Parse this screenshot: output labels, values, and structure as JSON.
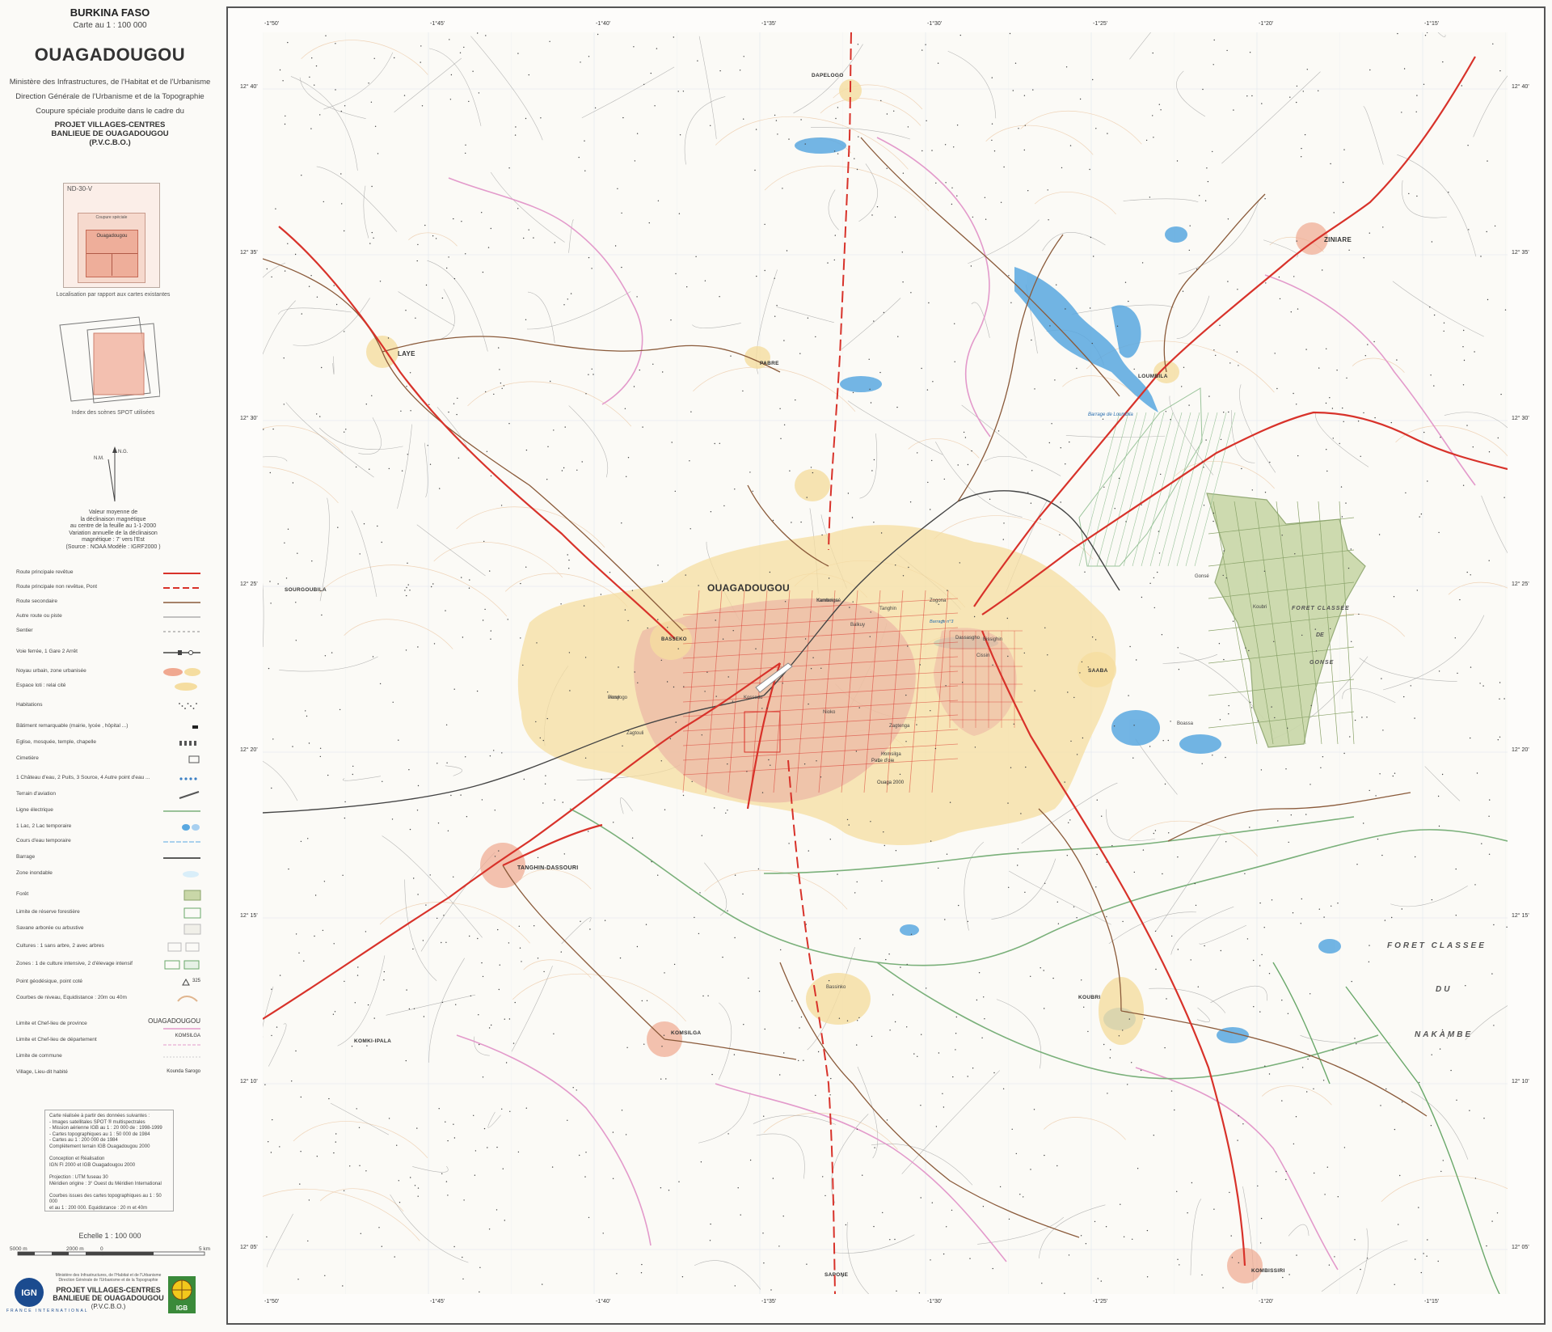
{
  "sidebar": {
    "country": "BURKINA FASO",
    "scale": "Carte au 1 : 100 000",
    "title": "OUAGADOUGOU",
    "ministry": "Ministère des Infrastructures, de l'Habitat et de l'Urbanisme",
    "direction": "Direction Générale de l'Urbanisme et de la Topographie",
    "coupure": "Coupure spéciale produite dans le cadre du",
    "project_1": "PROJET VILLAGES-CENTRES",
    "project_2": "BANLIEUE DE OUAGADOUGOU",
    "project_3": "(P.V.C.B.O.)",
    "location_sheet": "ND-30-V",
    "location_special": "Coupure spéciale",
    "location_city": "Ouagadougou",
    "location_caption": "Localisation par rapport aux cartes existantes",
    "spot_caption": "Index des scènes SPOT utilisées",
    "north_labels": {
      "ng": "N.G.",
      "nm": "N.M."
    },
    "declination_lines": [
      "Valeur moyenne de",
      "la déclinaison magnétique",
      "au centre de la feuille au 1-1-2000",
      "Variation annuelle de la déclinaison",
      "magnétique : 7' vers l'Est",
      "(Source : NOAA Modèle : IGRF2000 )"
    ]
  },
  "legend": [
    {
      "label": "Route principale revêtue",
      "symbol": "red-line"
    },
    {
      "label": "Route principale non revêtue,  Pont",
      "symbol": "red-dash"
    },
    {
      "label": "Route secondaire",
      "symbol": "brown-line"
    },
    {
      "label": "Autre route ou piste",
      "symbol": "grey-line"
    },
    {
      "label": "Sentier",
      "symbol": "grey-dash"
    },
    {
      "label": "Voie ferrée,  1 Gare  2 Arrêt",
      "symbol": "rail"
    },
    {
      "label": "Noyau urbain, zone urbanisée",
      "symbol": "urban"
    },
    {
      "label": "Espace loti : relai cité",
      "symbol": "yellow-fill"
    },
    {
      "label": "Habitations",
      "symbol": "dots"
    },
    {
      "label": "Bâtiment remarquable (mairie, lycée , hôpital ...)",
      "symbol": "black-block"
    },
    {
      "label": "Eglise, mosquée, temple, chapelle",
      "symbol": "church"
    },
    {
      "label": "Cimetière",
      "symbol": "cemetery"
    },
    {
      "label": "1 Château d'eau, 2 Puits, 3 Source, 4 Autre point d'eau ...",
      "symbol": "water-points"
    },
    {
      "label": "Terrain d'aviation",
      "symbol": "airfield"
    },
    {
      "label": "Ligne électrique",
      "symbol": "power"
    },
    {
      "label": "1 Lac, 2 Lac temporaire",
      "symbol": "lake"
    },
    {
      "label": "Cours d'eau temporaire",
      "symbol": "stream"
    },
    {
      "label": "Barrage",
      "symbol": "dam"
    },
    {
      "label": "Zone inondable",
      "symbol": "flood"
    },
    {
      "label": "Forêt",
      "symbol": "forest"
    },
    {
      "label": "Limite de réserve forestière",
      "symbol": "reserve"
    },
    {
      "label": "Savane arborée ou arbustive",
      "symbol": "savanna"
    },
    {
      "label": "Cultures : 1 sans arbre, 2 avec arbres",
      "symbol": "crops"
    },
    {
      "label": "Zones : 1 de culture intensive,   2 d'élevage intensif",
      "symbol": "zones"
    },
    {
      "label": "Point géodésique, point coté",
      "symbol": "geodetic"
    },
    {
      "label": "Courbes de niveau, Equidistance : 20m ou 40m",
      "symbol": "contours"
    },
    {
      "label": "Limite et Chef-lieu de province",
      "symbol": "province"
    },
    {
      "label": "Limite et Chef-lieu de département",
      "symbol": "department"
    },
    {
      "label": "Limite de commune",
      "symbol": "commune"
    },
    {
      "label": "Village, Lieu-dit habité",
      "symbol": "village"
    }
  ],
  "legend_values": {
    "province": "OUAGADOUGOU",
    "department": "KOMSILGA",
    "village_1": "Kounda",
    "village_2": "Sarogo",
    "geodetic": "325"
  },
  "notes": [
    "Carte réalisée à partir des données suivantes :",
    "- Images satellitales SPOT ® multispectrales",
    "- Mission aérienne IGB au 1 : 20 000 de : 1998-1999",
    "- Cartes topographiques au 1 : 50 000 de 1984",
    "- Cartes au 1 : 200 000 de 1984",
    "Complètement terrain IGB Ouagadougou 2000",
    "",
    "Conception et Réalisation",
    "IGN FI 2000 et IGB Ouagadougou 2000",
    "",
    "Projection : UTM fuseau 30",
    "Méridien origine : 3° Ouest du Méridien International",
    "",
    "Courbes issues des cartes topographiques au 1 : 50 000",
    "et au 1 : 200 000. Equidistance : 20 m et 40m"
  ],
  "scale_bar": {
    "title": "Echelle   1 : 100 000",
    "left": "5000 m",
    "middle": "2000 m",
    "zero": "0",
    "right": "5 km"
  },
  "footer": {
    "small_1": "Ministère des Infrastructures, de l'Habitat et de l'Urbanisme",
    "small_2": "Direction Générale de l'Urbanisme et de la Topographie",
    "project_1": "PROJET VILLAGES-CENTRES",
    "project_2": "BANLIEUE DE OUAGADOUGOU",
    "project_3": "(P.V.C.B.O.)",
    "ign": "IGN",
    "ign_sub": "FRANCE INTERNATIONAL",
    "igb": "IGB"
  },
  "map": {
    "lon_ticks": [
      "-1°50'",
      "-1°45'",
      "-1°40'",
      "-1°35'",
      "-1°30'",
      "-1°25'",
      "-1°20'",
      "-1°15'"
    ],
    "lat_ticks": [
      "12° 40'",
      "12° 35'",
      "12° 30'",
      "12° 25'",
      "12° 20'",
      "12° 15'",
      "12° 10'",
      "12° 05'"
    ],
    "cities": [
      {
        "name": "OUAGADOUGOU",
        "type": "capital"
      },
      {
        "name": "ZINIARE",
        "type": "town"
      },
      {
        "name": "LAYE",
        "type": "town"
      },
      {
        "name": "TANGHIN-DASSOURI",
        "type": "town"
      },
      {
        "name": "KOMSILGA",
        "type": "town"
      },
      {
        "name": "KOMBISSIRI",
        "type": "town"
      },
      {
        "name": "SAABA",
        "type": "town"
      },
      {
        "name": "KOUBRI",
        "type": "town"
      },
      {
        "name": "LOUMBILA",
        "type": "town"
      },
      {
        "name": "PABRE",
        "type": "town"
      },
      {
        "name": "DAPELOGO",
        "type": "town"
      },
      {
        "name": "SOURGOUBILA",
        "type": "town"
      },
      {
        "name": "KOMKI-IPALA",
        "type": "town"
      },
      {
        "name": "SAPONE",
        "type": "town"
      },
      {
        "name": "BASSEKO",
        "type": "village"
      },
      {
        "name": "Kamboinsé",
        "type": "village"
      },
      {
        "name": "Pissy",
        "type": "village"
      },
      {
        "name": "Zagtouli",
        "type": "village"
      },
      {
        "name": "Bassinko",
        "type": "village"
      },
      {
        "name": "Komsilga",
        "type": "village"
      },
      {
        "name": "Nioko",
        "type": "village"
      },
      {
        "name": "Balkuy",
        "type": "village"
      },
      {
        "name": "Tanghin",
        "type": "village"
      },
      {
        "name": "Zagtenga",
        "type": "village"
      },
      {
        "name": "Bissighin",
        "type": "village"
      },
      {
        "name": "Cissin",
        "type": "village"
      },
      {
        "name": "Dassasgho",
        "type": "village"
      },
      {
        "name": "Zogona",
        "type": "village"
      },
      {
        "name": "Kossodo",
        "type": "village"
      },
      {
        "name": "Boassa",
        "type": "village"
      },
      {
        "name": "Koubri",
        "type": "village"
      },
      {
        "name": "Gonsé",
        "type": "village"
      },
      {
        "name": "Yamtenga",
        "type": "village"
      },
      {
        "name": "Bendogo",
        "type": "village"
      }
    ],
    "features": {
      "forest_gonse": [
        "FORET CLASSEE",
        "DE",
        "GONSE"
      ],
      "forest_nakambe": [
        "FORET CLASSEE",
        "DU",
        "NAKAMBE"
      ],
      "barrage_loumbila": "Barrage de Loumbila",
      "ouaga2000": "Ouaga 2000",
      "patte": "Patte d'oie",
      "barrage_ouaga": "Barrage n°3"
    },
    "colors": {
      "urban": "#f5dda0",
      "core": "#e9a9a0",
      "road_main": "#d8322a",
      "road_secondary": "#8a5a3a",
      "boundary": "#e39acb",
      "water": "#5aa8e0",
      "forest": "#c9d7a8",
      "power_line": "#7ab07a"
    }
  }
}
